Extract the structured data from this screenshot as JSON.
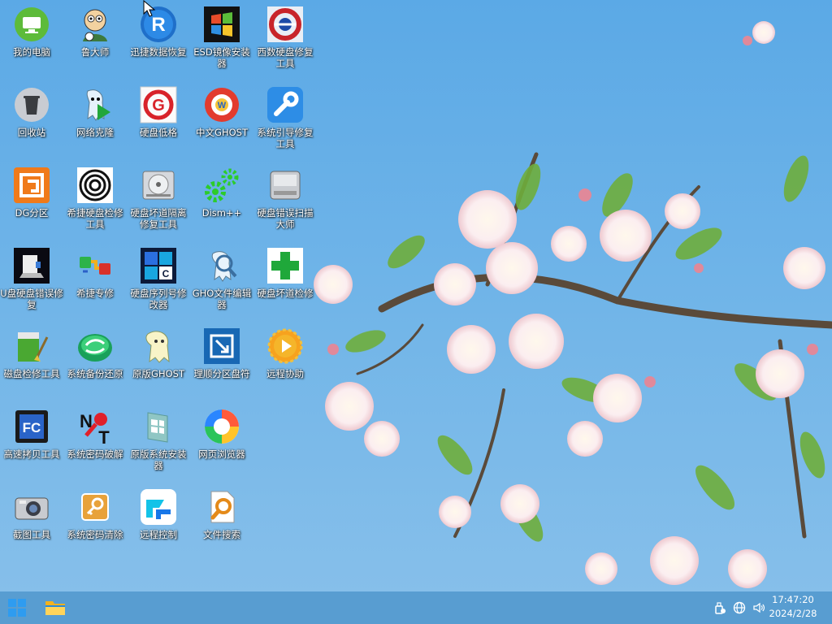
{
  "desktop": {
    "icons": [
      {
        "label": "我的电脑",
        "icon": "computer-icon"
      },
      {
        "label": "鲁大师",
        "icon": "ludashi-icon"
      },
      {
        "label": "迅捷数据恢复",
        "icon": "data-recovery-icon"
      },
      {
        "label": "ESD镜像安装器",
        "icon": "esd-installer-icon"
      },
      {
        "label": "西数硬盘修复工具",
        "icon": "wd-disk-repair-icon"
      },
      {
        "label": "回收站",
        "icon": "recycle-bin-icon"
      },
      {
        "label": "网络克隆",
        "icon": "network-clone-icon"
      },
      {
        "label": "硬盘低格",
        "icon": "disk-low-format-icon"
      },
      {
        "label": "中文GHOST",
        "icon": "chinese-ghost-icon"
      },
      {
        "label": "系统引导修复工具",
        "icon": "boot-repair-icon"
      },
      {
        "label": "DG分区",
        "icon": "diskgenius-icon"
      },
      {
        "label": "希捷硬盘检修工具",
        "icon": "seagate-tool-icon"
      },
      {
        "label": "硬盘坏道隔离修复工具",
        "icon": "bad-sector-isolate-icon"
      },
      {
        "label": "Dism++",
        "icon": "dism-icon"
      },
      {
        "label": "硬盘错误扫描大师",
        "icon": "disk-error-scan-icon"
      },
      {
        "label": "U盘硬盘错误修复",
        "icon": "usb-disk-repair-icon"
      },
      {
        "label": "希捷专修",
        "icon": "seagate-repair-icon"
      },
      {
        "label": "硬盘序列号修改器",
        "icon": "disk-serial-icon"
      },
      {
        "label": "GHO文件编辑器",
        "icon": "gho-editor-icon"
      },
      {
        "label": "硬盘坏道检修",
        "icon": "bad-sector-check-icon"
      },
      {
        "label": "磁盘检修工具",
        "icon": "disk-check-icon"
      },
      {
        "label": "系统备份还原",
        "icon": "backup-restore-icon"
      },
      {
        "label": "原版GHOST",
        "icon": "original-ghost-icon"
      },
      {
        "label": "理顺分区盘符",
        "icon": "partition-letter-icon"
      },
      {
        "label": "远程协助",
        "icon": "remote-assist-icon"
      },
      {
        "label": "高速拷贝工具",
        "icon": "fastcopy-icon"
      },
      {
        "label": "系统密码破解",
        "icon": "ntpwedit-icon"
      },
      {
        "label": "原版系统安装器",
        "icon": "win-installer-icon"
      },
      {
        "label": "网页浏览器",
        "icon": "browser-icon"
      },
      {
        "label": "截图工具",
        "icon": "screenshot-camera-icon"
      },
      {
        "label": "系统密码清除",
        "icon": "password-clear-icon"
      },
      {
        "label": "远程控制",
        "icon": "remote-control-icon"
      },
      {
        "label": "文件搜索",
        "icon": "file-search-icon"
      }
    ]
  },
  "taskbar": {
    "start_icon": "windows-start-icon",
    "explorer_icon": "file-explorer-icon",
    "tray_icons": [
      "usb-eject-icon",
      "network-globe-icon",
      "volume-icon"
    ],
    "time": "17:47:20",
    "date": "2024/2/28"
  },
  "colors": {
    "accent": "#3b8fd6",
    "sky": "#6fb4e8"
  }
}
